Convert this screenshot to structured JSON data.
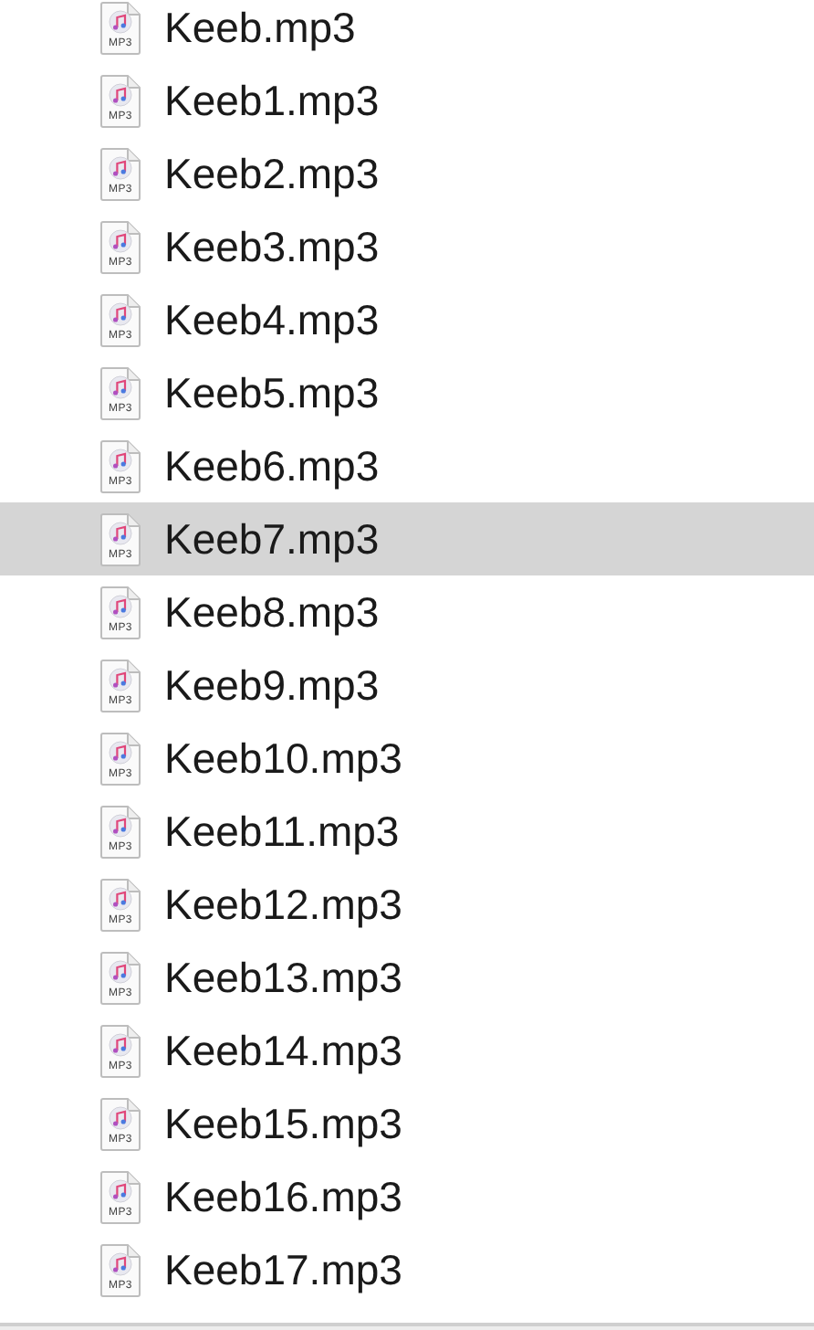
{
  "files": [
    {
      "name": "Keeb.mp3",
      "icon_label": "MP3",
      "selected": false
    },
    {
      "name": "Keeb1.mp3",
      "icon_label": "MP3",
      "selected": false
    },
    {
      "name": "Keeb2.mp3",
      "icon_label": "MP3",
      "selected": false
    },
    {
      "name": "Keeb3.mp3",
      "icon_label": "MP3",
      "selected": false
    },
    {
      "name": "Keeb4.mp3",
      "icon_label": "MP3",
      "selected": false
    },
    {
      "name": "Keeb5.mp3",
      "icon_label": "MP3",
      "selected": false
    },
    {
      "name": "Keeb6.mp3",
      "icon_label": "MP3",
      "selected": false
    },
    {
      "name": "Keeb7.mp3",
      "icon_label": "MP3",
      "selected": true
    },
    {
      "name": "Keeb8.mp3",
      "icon_label": "MP3",
      "selected": false
    },
    {
      "name": "Keeb9.mp3",
      "icon_label": "MP3",
      "selected": false
    },
    {
      "name": "Keeb10.mp3",
      "icon_label": "MP3",
      "selected": false
    },
    {
      "name": "Keeb11.mp3",
      "icon_label": "MP3",
      "selected": false
    },
    {
      "name": "Keeb12.mp3",
      "icon_label": "MP3",
      "selected": false
    },
    {
      "name": "Keeb13.mp3",
      "icon_label": "MP3",
      "selected": false
    },
    {
      "name": "Keeb14.mp3",
      "icon_label": "MP3",
      "selected": false
    },
    {
      "name": "Keeb15.mp3",
      "icon_label": "MP3",
      "selected": false
    },
    {
      "name": "Keeb16.mp3",
      "icon_label": "MP3",
      "selected": false
    },
    {
      "name": "Keeb17.mp3",
      "icon_label": "MP3",
      "selected": false
    }
  ]
}
